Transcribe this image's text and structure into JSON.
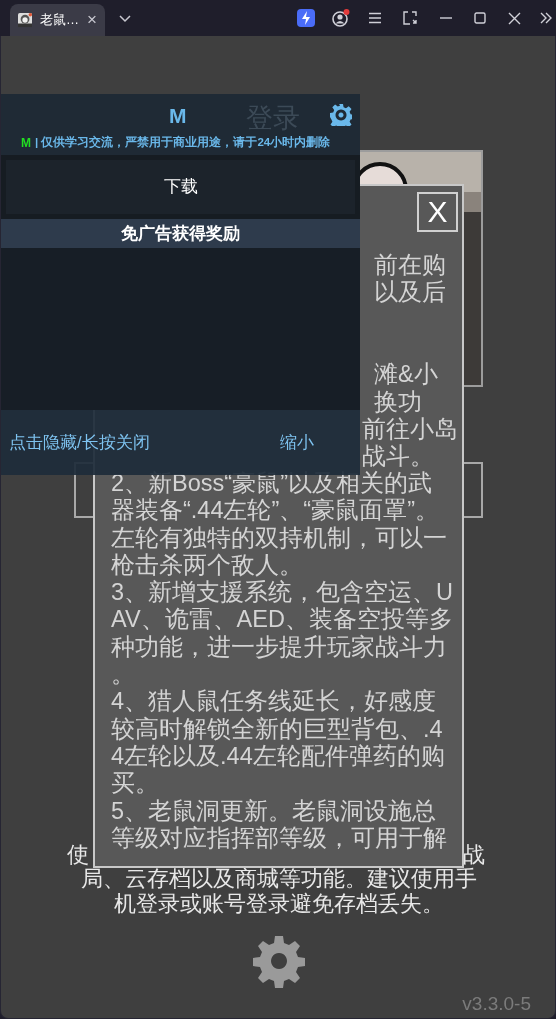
{
  "browser": {
    "tab": {
      "title": "老鼠…",
      "close": "×"
    }
  },
  "app": {
    "title": "登录",
    "notice_start": "使",
    "notice_end": "战",
    "notice_lines": [
      "局、云存档以及商城等功能。建议使用手",
      "机登录或账号登录避免存档丢失。"
    ],
    "version": "v3.3.0-5"
  },
  "modal": {
    "close_label": "X",
    "fragments": [
      "前在购",
      "以及后",
      "滩&小",
      "换功",
      "前往小岛",
      "战斗。"
    ],
    "lines": [
      "2、新Boss“豪鼠”以及相关的武",
      "器装备“.44左轮”、“豪鼠面罩”。",
      "左轮有独特的双持机制，可以一",
      "枪击杀两个敌人。",
      "3、新增支援系统，包含空运、U",
      "AV、诡雷、AED、装备空投等多",
      "种功能，进一步提升玩家战斗力",
      "。",
      "4、猎人鼠任务线延长，好感度",
      "较高时解锁全新的巨型背包、.4",
      "4左轮以及.44左轮配件弹药的购",
      "买。",
      "5、老鼠洞更新。老鼠洞设施总",
      "等级对应指挥部等级，可用于解"
    ]
  },
  "overlay": {
    "logo": "M",
    "badge": "M",
    "notice": "| 仅供学习交流，严禁用于商业用途，请于24小时内删除",
    "download": "下载",
    "reward": "免广告获得奖励",
    "hide_hint": "点击隐藏/长按关闭",
    "shrink": "缩小"
  }
}
